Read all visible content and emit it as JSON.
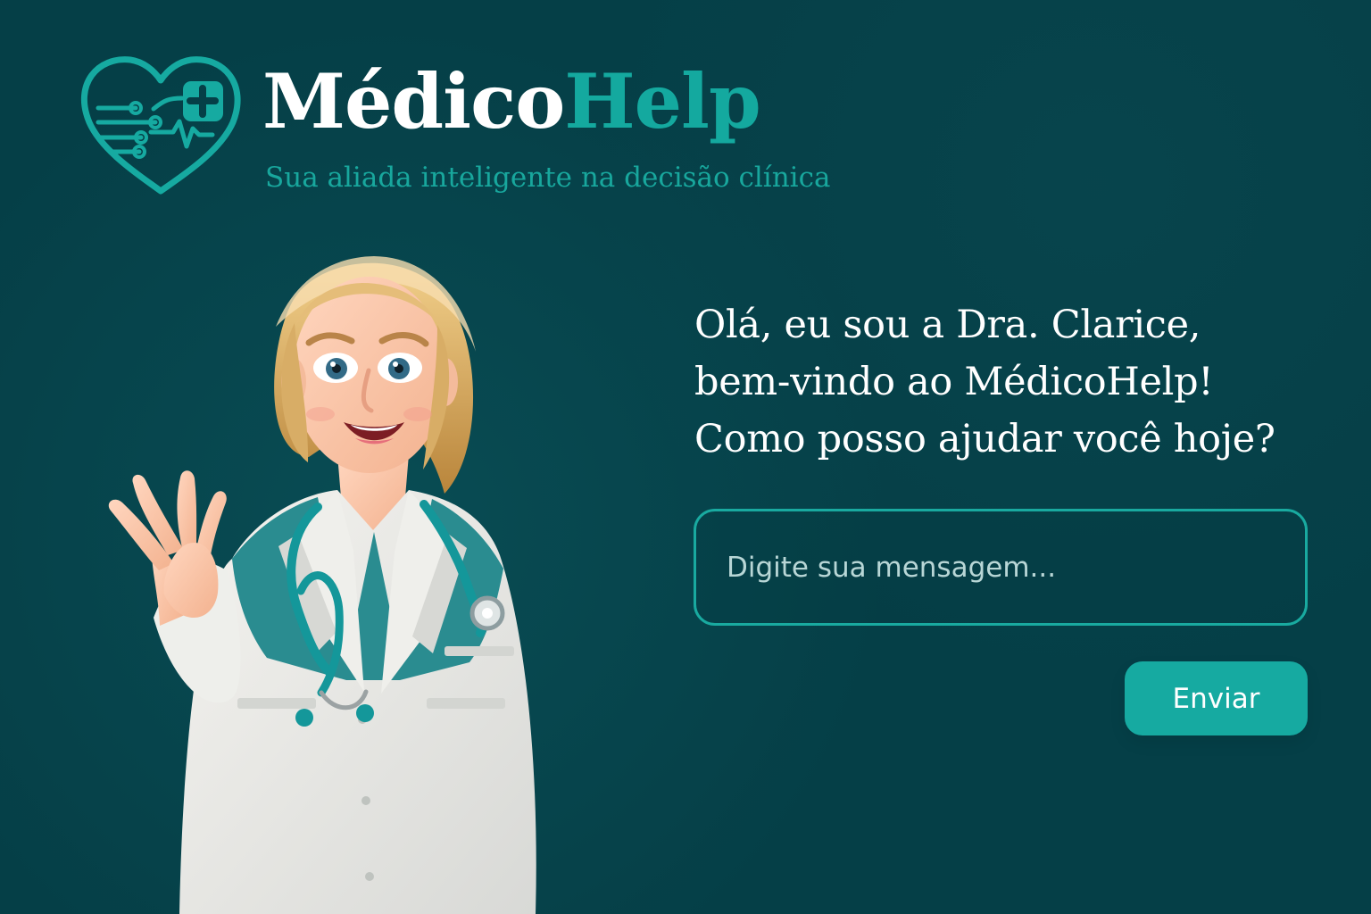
{
  "brand": {
    "name_part_1": "Médico",
    "name_part_2": "Help",
    "tagline": "Sua aliada inteligente na decisão clínica"
  },
  "assistant": {
    "greeting_lines": [
      "Olá, eu sou a Dra. Clarice,",
      "bem-vindo ao MédicoHelp!",
      "Como posso ajudar você hoje?"
    ]
  },
  "chat": {
    "input_value": "",
    "input_placeholder": "Digite sua mensagem...",
    "send_label": "Enviar"
  },
  "colors": {
    "background": "#053f47",
    "accent": "#16aaa1",
    "text": "#ffffff",
    "placeholder": "#b8d6d6"
  },
  "icons": {
    "logo": "heart-medical-circuit-icon"
  }
}
